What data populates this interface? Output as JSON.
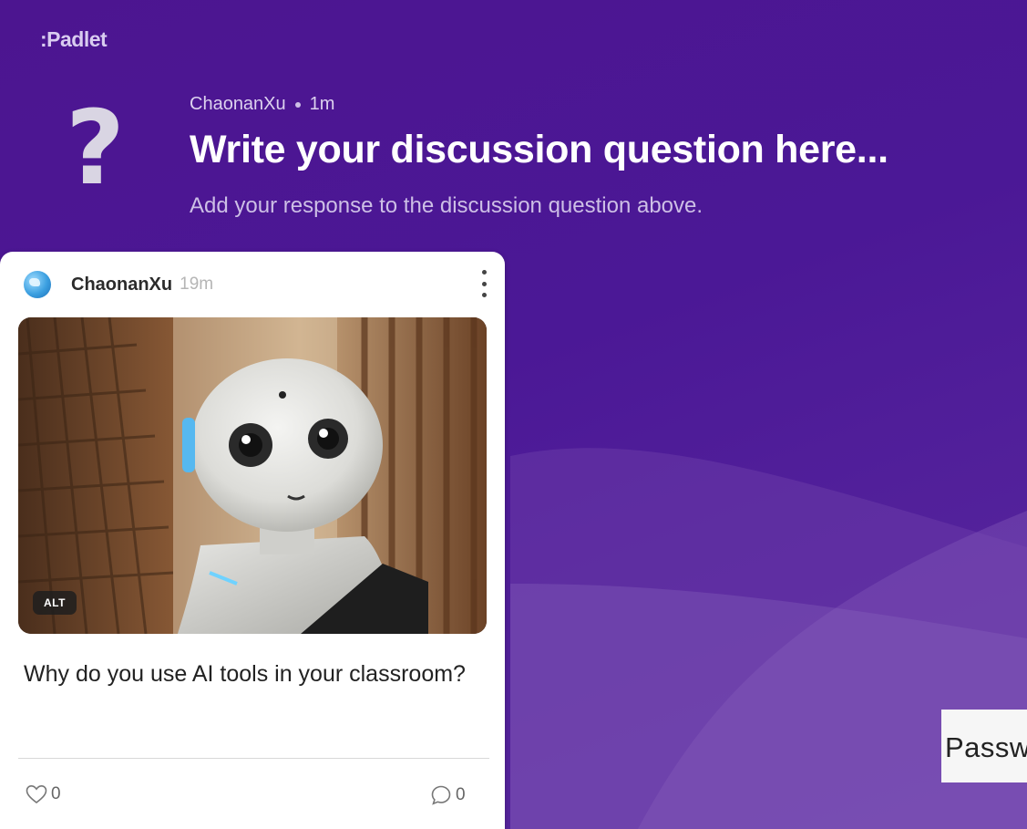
{
  "app": {
    "logo": ":Padlet"
  },
  "header": {
    "author": "ChaonanXu",
    "age": "1m",
    "title": "Write your discussion question here...",
    "subtitle": "Add your response to the discussion question above."
  },
  "post": {
    "author": "ChaonanXu",
    "age": "19m",
    "image_badge": "ALT",
    "text": "Why do you use AI tools in your classroom?",
    "likes": "0",
    "comments": "0"
  },
  "overlay": {
    "password_partial": "Passw"
  },
  "colors": {
    "background": "#4a1790",
    "card": "#ffffff",
    "title": "#ffffff",
    "subtitle": "#cdbfe6"
  },
  "icons": [
    "question-mark-icon",
    "globe-avatar-icon",
    "kebab-menu-icon",
    "heart-icon",
    "comment-icon"
  ]
}
